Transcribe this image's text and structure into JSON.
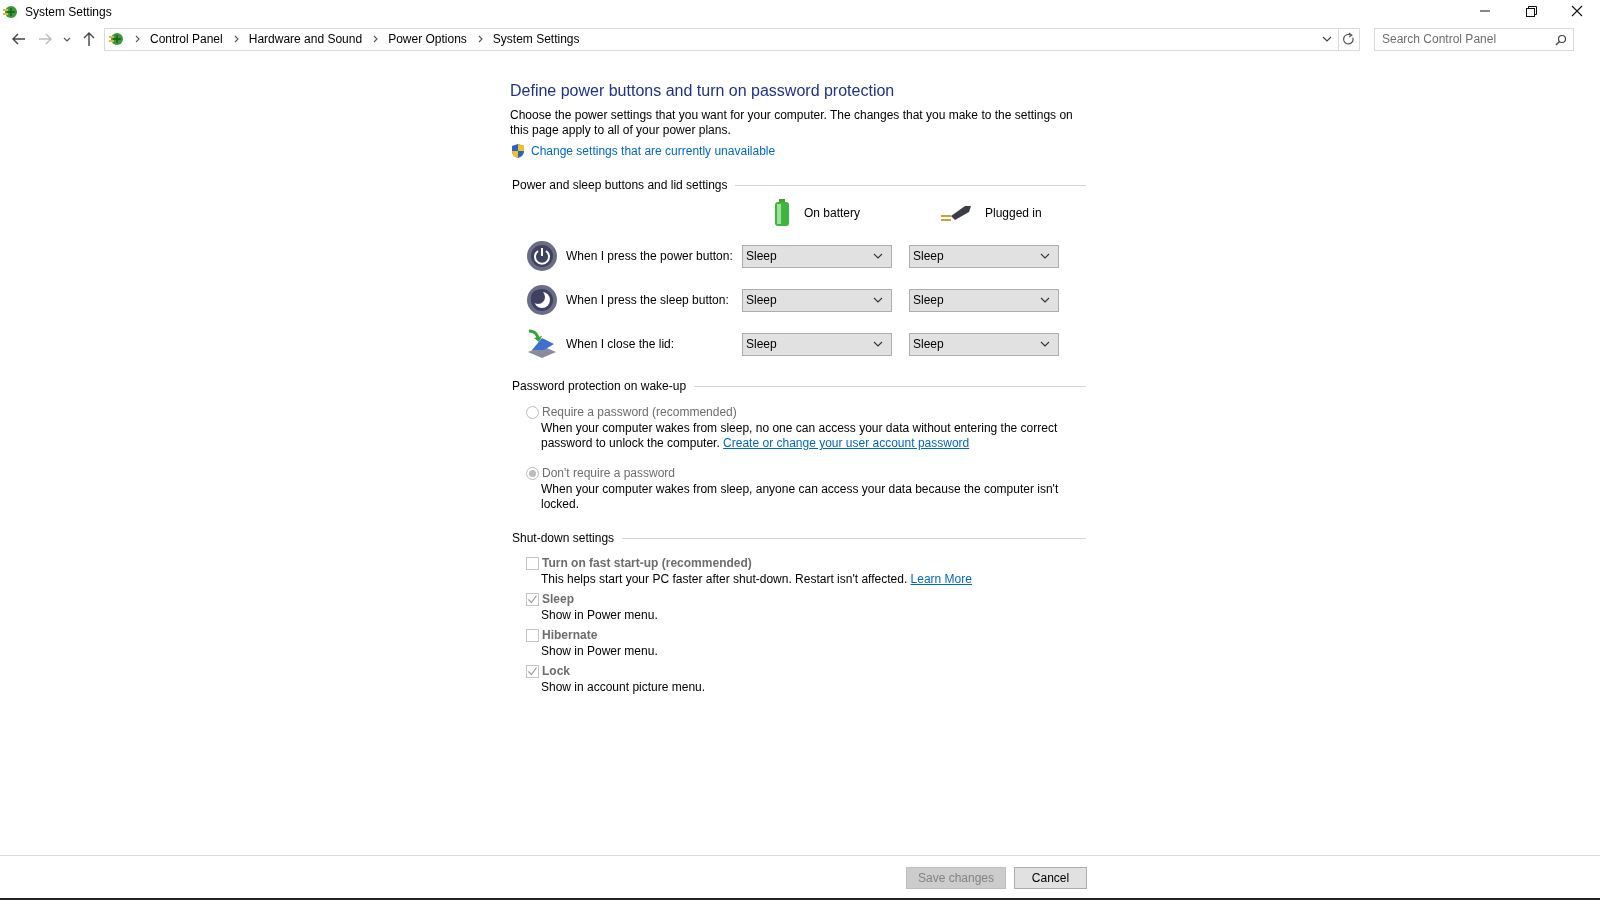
{
  "window": {
    "title": "System Settings"
  },
  "address_bar": {
    "breadcrumbs": [
      "Control Panel",
      "Hardware and Sound",
      "Power Options",
      "System Settings"
    ]
  },
  "search": {
    "placeholder": "Search Control Panel"
  },
  "heading": "Define power buttons and turn on password protection",
  "intro": "Choose the power settings that you want for your computer. The changes that you make to the settings on this page apply to all of your power plans.",
  "admin_link": "Change settings that are currently unavailable",
  "power_section": {
    "title": "Power and sleep buttons and lid settings",
    "columns": [
      {
        "label": "On battery",
        "kind": "battery"
      },
      {
        "label": "Plugged in",
        "kind": "plug"
      }
    ],
    "rows": [
      {
        "kind": "power",
        "label": "When I press the power button:",
        "on_battery": "Sleep",
        "plugged_in": "Sleep"
      },
      {
        "kind": "sleep",
        "label": "When I press the sleep button:",
        "on_battery": "Sleep",
        "plugged_in": "Sleep"
      },
      {
        "kind": "lid",
        "label": "When I close the lid:",
        "on_battery": "Sleep",
        "plugged_in": "Sleep"
      }
    ]
  },
  "password_section": {
    "title": "Password protection on wake-up",
    "options": [
      {
        "label": "Require a password (recommended)",
        "selected": false,
        "disabled": true,
        "description": "When your computer wakes from sleep, no one can access your data without entering the correct password to unlock the computer.",
        "link": "Create or change your user account password"
      },
      {
        "label": "Don't require a password",
        "selected": true,
        "disabled": true,
        "description": "When your computer wakes from sleep, anyone can access your data because the computer isn't locked."
      }
    ]
  },
  "shutdown_section": {
    "title": "Shut-down settings",
    "items": [
      {
        "label": "Turn on fast start-up (recommended)",
        "checked": false,
        "disabled": true,
        "description": "This helps start your PC faster after shut-down. Restart isn't affected.",
        "link": "Learn More"
      },
      {
        "label": "Sleep",
        "checked": true,
        "disabled": true,
        "description": "Show in Power menu."
      },
      {
        "label": "Hibernate",
        "checked": false,
        "disabled": true,
        "description": "Show in Power menu."
      },
      {
        "label": "Lock",
        "checked": true,
        "disabled": true,
        "description": "Show in account picture menu."
      }
    ]
  },
  "buttons": [
    {
      "label": "Save changes",
      "disabled": true
    },
    {
      "label": "Cancel",
      "disabled": false
    }
  ]
}
